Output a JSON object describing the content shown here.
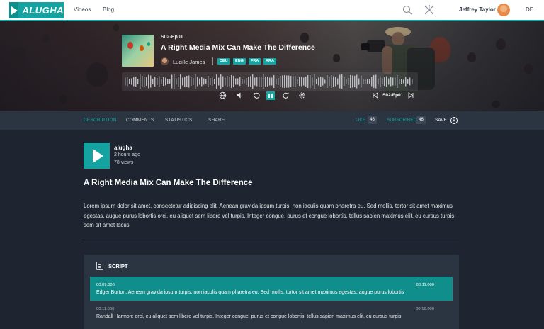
{
  "nav": {
    "logo_text": "ALUGHA",
    "links": [
      "Videos",
      "Blog"
    ],
    "user_name": "Jeffrey Taylor",
    "language": "DE"
  },
  "player": {
    "episode_code": "S02-Ep01",
    "title": "A Right Media Mix Can Make The Difference",
    "speaker": "Lucille James",
    "languages": [
      "DEU",
      "ENG",
      "FRA",
      "ARA"
    ],
    "nav_episode_code": "S02-Ep01",
    "state": "playing"
  },
  "tabs": {
    "items": [
      "DESCRIPTION",
      "COMMENTS",
      "STATISTICS",
      "SHARE"
    ],
    "active": "DESCRIPTION",
    "like_label": "LIKE",
    "like_count": "46",
    "subscribed_label": "SUBSCRIBED",
    "subscribed_count": "46",
    "save_label": "SAVE"
  },
  "channel": {
    "name": "alugha",
    "time_ago": "2 hours ago",
    "views": "78 views"
  },
  "content": {
    "title": "A Right Media Mix Can Make The Difference",
    "description": "Lorem ipsum dolor sit amet, consectetur adipiscing elit. Aenean gravida ipsum turpis, non iaculis quam pharetra eu. Sed mollis, tortor sit amet maximus egestas, augue purus lobortis orci, eu aliquet sem libero vel turpis. Integer congue, purus et congue lobortis, tellus sapien maximus elit, eu cursus turpis sem sit amet lacus."
  },
  "script": {
    "title": "SCRIPT",
    "segments": [
      {
        "start": "00:09.000",
        "end": "00:11.000",
        "text": "Edger Burton: Aenean gravida ipsum turpis, non iaculis quam pharetra eu. Sed mollis, tortor sit amet maximus egestas, augue purus lobortis",
        "active": true
      },
      {
        "start": "00:11.000",
        "end": "00:16.000",
        "text": "Randall Harmon: orci, eu aliquet sem libero vel turpis. Integer congue, purus et congue lobortis, tellus sapien maximus elit, eu cursus turpis",
        "active": false
      }
    ]
  },
  "colors": {
    "accent": "#14a3a0",
    "background": "#1f2530",
    "panel": "#2b3441"
  }
}
